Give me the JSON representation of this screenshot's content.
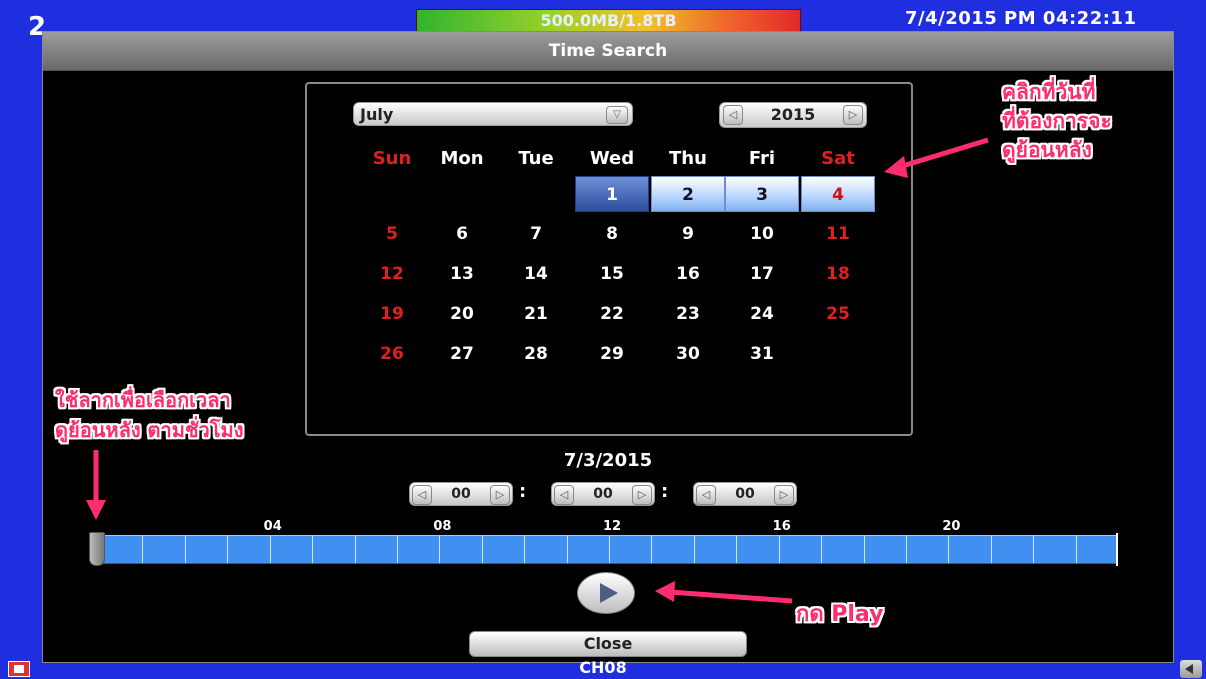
{
  "screen": {
    "top_left_fragment": "2",
    "storage": "500.0MB/1.8TB",
    "clock": "7/4/2015 PM 04:22:11",
    "channel": "CH08"
  },
  "dialog": {
    "title": "Time Search",
    "close_label": "Close"
  },
  "calendar": {
    "month": "July",
    "year": "2015",
    "weekdays": [
      "Sun",
      "Mon",
      "Tue",
      "Wed",
      "Thu",
      "Fri",
      "Sat"
    ],
    "days": [
      "1",
      "2",
      "3",
      "4",
      "5",
      "6",
      "7",
      "8",
      "9",
      "10",
      "11",
      "12",
      "13",
      "14",
      "15",
      "16",
      "17",
      "18",
      "19",
      "20",
      "21",
      "22",
      "23",
      "24",
      "25",
      "26",
      "27",
      "28",
      "29",
      "30",
      "31"
    ],
    "days_with_recordings": [
      "1",
      "2",
      "3",
      "4"
    ],
    "selected_day": "1"
  },
  "time_search": {
    "selected_date": "7/3/2015",
    "hour": "00",
    "minute": "00",
    "second": "00",
    "separator": ":",
    "hour_marks": [
      "04",
      "08",
      "12",
      "16",
      "20"
    ]
  },
  "annotations": {
    "calendar_hint_line1": "คลิกที่วันที่",
    "calendar_hint_line2": "ที่ต้องการจะ",
    "calendar_hint_line3": "ดูย้อนหลัง",
    "timeline_hint_line1": "ใช้ลากเพื่อเลือกเวลา",
    "timeline_hint_line2": "ดูย้อนหลัง ตามชั่วโมง",
    "play_hint": "กด Play"
  },
  "colors": {
    "desktop_bg": "#1f2fe0",
    "weekend": "#e02020",
    "timeline": "#3f90f0",
    "annotation": "#ff2d6f"
  }
}
